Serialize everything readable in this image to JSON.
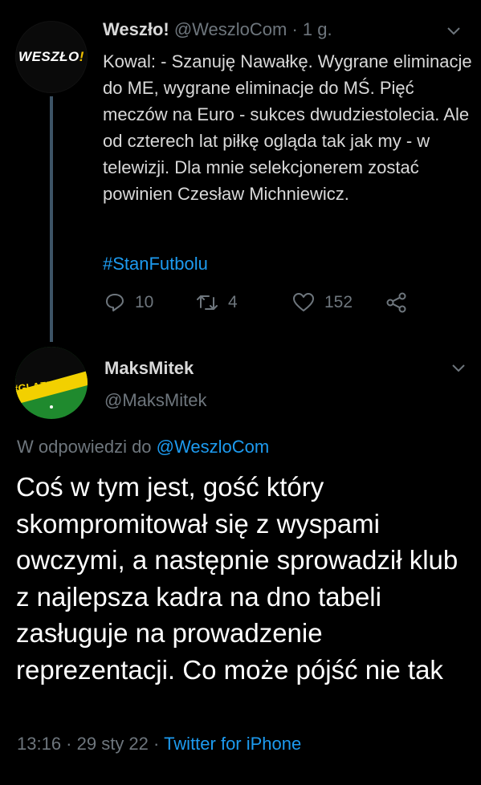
{
  "parent_tweet": {
    "avatar_logo": "WESZŁO!",
    "display_name": "Weszło!",
    "handle": "@WeszloCom",
    "time": "1 g.",
    "text": "Kowal: - Szanuję Nawałkę. Wygrane eliminacje do ME, wygrane eliminacje do MŚ. Pięć meczów na Euro - sukces dwudziestolecia. Ale od czterech lat piłkę ogląda tak jak my - w telewizji. Dla mnie selekcjonerem zostać powinien Czesław Michniewicz.",
    "hashtag": "#StanFutbolu",
    "replies": "10",
    "retweets": "4",
    "likes": "152"
  },
  "reply_tweet": {
    "avatar_text": "#GLAZERSOUT",
    "display_name": "MaksMitek",
    "handle": "@MaksMitek",
    "reply_prefix": "W odpowiedzi do",
    "reply_to": "@WeszloCom",
    "text": "Coś w tym jest, gość który skompromitował się z wyspami owczymi, a następnie sprowadził klub z najlepsza kadra na dno tabeli zasługuje na prowadzenie reprezentacji. Co może pójść nie tak",
    "time": "13:16",
    "date": "29 sty 22",
    "source": "Twitter for iPhone"
  },
  "colors": {
    "background": "#000000",
    "text": "#d9d9d9",
    "muted": "#6e767d",
    "link": "#1d9bf0",
    "thread_line": "#3d5466"
  }
}
